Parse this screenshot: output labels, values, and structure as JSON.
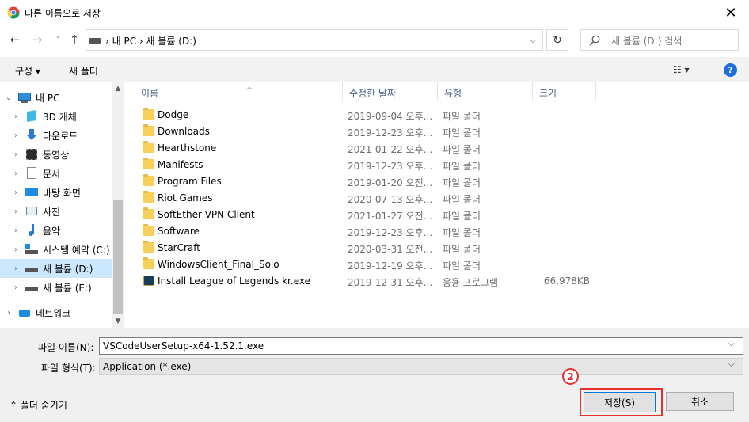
{
  "window": {
    "title": "다른 이름으로 저장",
    "close_glyph": "✕"
  },
  "nav": {
    "back_glyph": "←",
    "forward_glyph": "→",
    "recent_glyph": "˅",
    "up_glyph": "↑",
    "breadcrumb": "› 내 PC  ›  새 볼륨 (D:)",
    "dropdown_glyph": "⌵",
    "refresh_glyph": "↻",
    "search_placeholder": "새 볼륨 (D:) 검색"
  },
  "toolbar": {
    "organize_label": "구성 ▾",
    "new_folder_label": "새 폴더",
    "view_label": "☷ ▾",
    "help_label": "?"
  },
  "sidebar": {
    "items": [
      {
        "label": "내 PC",
        "icon": "pc-icon"
      },
      {
        "label": "3D 개체",
        "icon": "3d-objects-icon"
      },
      {
        "label": "다운로드",
        "icon": "downloads-icon"
      },
      {
        "label": "동영상",
        "icon": "videos-icon"
      },
      {
        "label": "문서",
        "icon": "documents-icon"
      },
      {
        "label": "바탕 화면",
        "icon": "desktop-icon"
      },
      {
        "label": "사진",
        "icon": "pictures-icon"
      },
      {
        "label": "음악",
        "icon": "music-icon"
      },
      {
        "label": "시스템 예약 (C:)",
        "icon": "system-drive-icon"
      },
      {
        "label": "새 볼륨 (D:)",
        "icon": "drive-icon",
        "selected": true
      },
      {
        "label": "새 볼륨 (E:)",
        "icon": "drive-icon"
      },
      {
        "label": "네트워크",
        "icon": "network-icon"
      }
    ]
  },
  "columns": {
    "name": "이름",
    "modified": "수정한 날짜",
    "type": "유형",
    "size": "크기"
  },
  "files": [
    {
      "name": "Dodge",
      "date": "2019-09-04 오후...",
      "type": "파일 폴더",
      "size": "",
      "icon": "folder-icon"
    },
    {
      "name": "Downloads",
      "date": "2019-12-23 오후...",
      "type": "파일 폴더",
      "size": "",
      "icon": "folder-icon"
    },
    {
      "name": "Hearthstone",
      "date": "2021-01-22 오후...",
      "type": "파일 폴더",
      "size": "",
      "icon": "folder-icon"
    },
    {
      "name": "Manifests",
      "date": "2019-12-23 오후...",
      "type": "파일 폴더",
      "size": "",
      "icon": "folder-icon"
    },
    {
      "name": "Program Files",
      "date": "2019-01-20 오전...",
      "type": "파일 폴더",
      "size": "",
      "icon": "folder-icon"
    },
    {
      "name": "Riot Games",
      "date": "2020-07-13 오후...",
      "type": "파일 폴더",
      "size": "",
      "icon": "folder-icon"
    },
    {
      "name": "SoftEther VPN Client",
      "date": "2021-01-27 오전...",
      "type": "파일 폴더",
      "size": "",
      "icon": "folder-icon"
    },
    {
      "name": "Software",
      "date": "2019-12-23 오후...",
      "type": "파일 폴더",
      "size": "",
      "icon": "folder-icon"
    },
    {
      "name": "StarCraft",
      "date": "2020-03-31 오전...",
      "type": "파일 폴더",
      "size": "",
      "icon": "folder-icon"
    },
    {
      "name": "WindowsClient_Final_Solo",
      "date": "2019-12-19 오후...",
      "type": "파일 폴더",
      "size": "",
      "icon": "folder-icon"
    },
    {
      "name": "Install League of Legends kr.exe",
      "date": "2019-12-31 오후...",
      "type": "응용 프로그램",
      "size": "66,978KB",
      "icon": "league-app-icon"
    }
  ],
  "form": {
    "filename_label": "파일 이름(N):",
    "filename_value": "VSCodeUserSetup-x64-1.52.1.exe",
    "filetype_label": "파일 형식(T):",
    "filetype_value": "Application (*.exe)",
    "dropdown_glyph": "⌵",
    "hide_folders_label": "⌃  폴더 숨기기",
    "save_label": "저장(S)",
    "cancel_label": "취소",
    "step_badge": "2"
  },
  "colors": {
    "selected_bg": "#cce8ff",
    "accent": "#0078d7",
    "highlight": "#e53030",
    "folder": "#f7cf5a"
  }
}
